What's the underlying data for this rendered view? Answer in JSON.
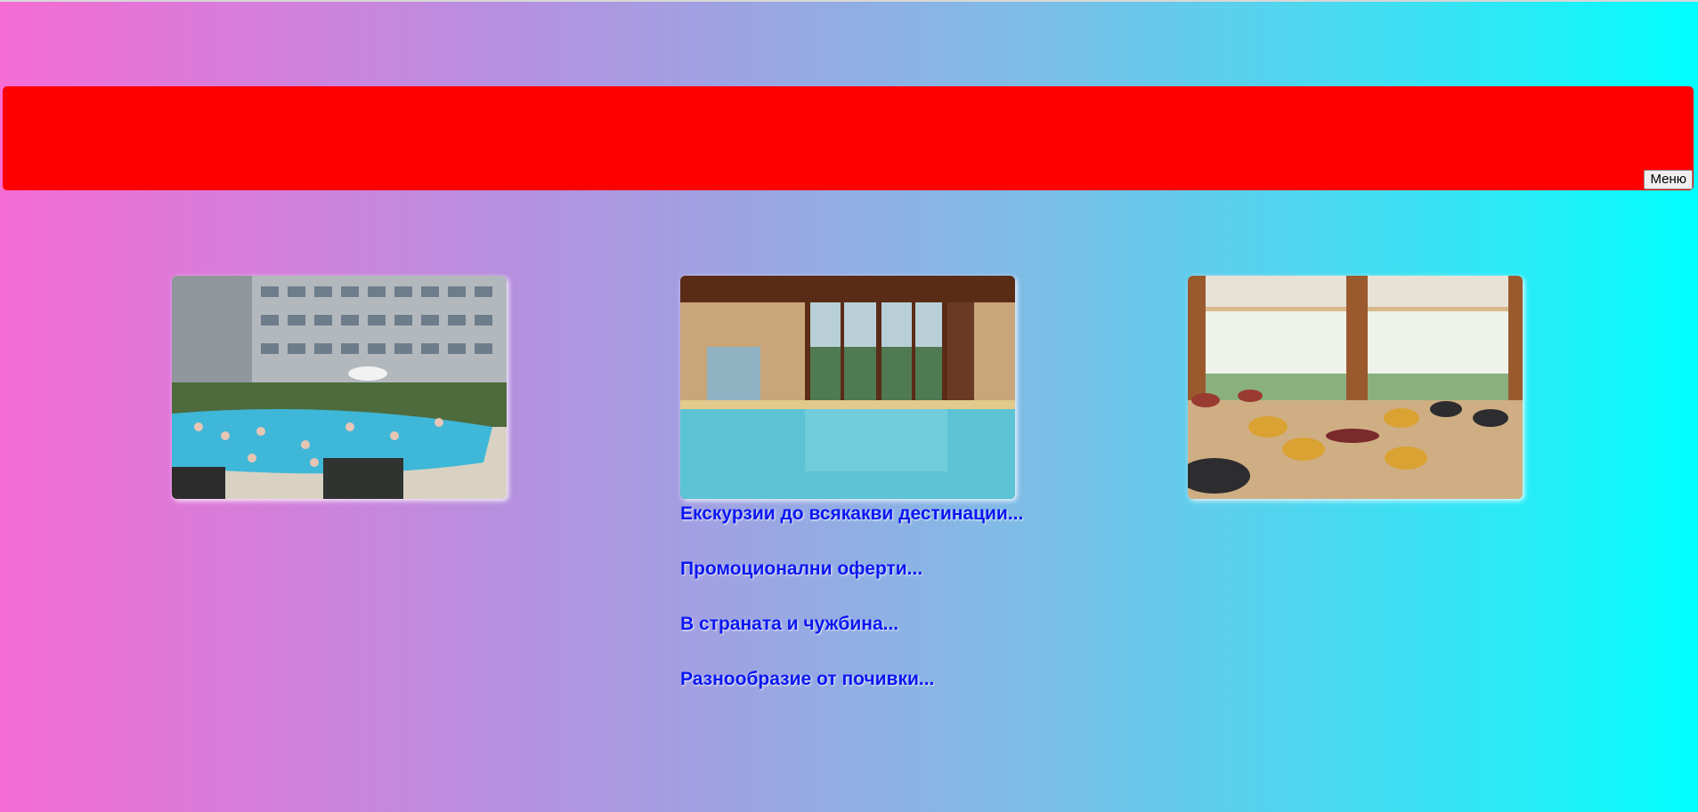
{
  "header": {
    "menu_label": "Меню"
  },
  "gallery": {
    "images": [
      {
        "name": "outdoor-pool-photo"
      },
      {
        "name": "indoor-pool-photo"
      },
      {
        "name": "lounge-photo"
      }
    ]
  },
  "links": [
    "Екскурзии до всякакви дестинации...",
    "Промоционални оферти...",
    "В страната и чужбина...",
    "Разнообразие от почивки..."
  ],
  "colors": {
    "banner": "#ff0000",
    "link": "#0b16f2"
  }
}
